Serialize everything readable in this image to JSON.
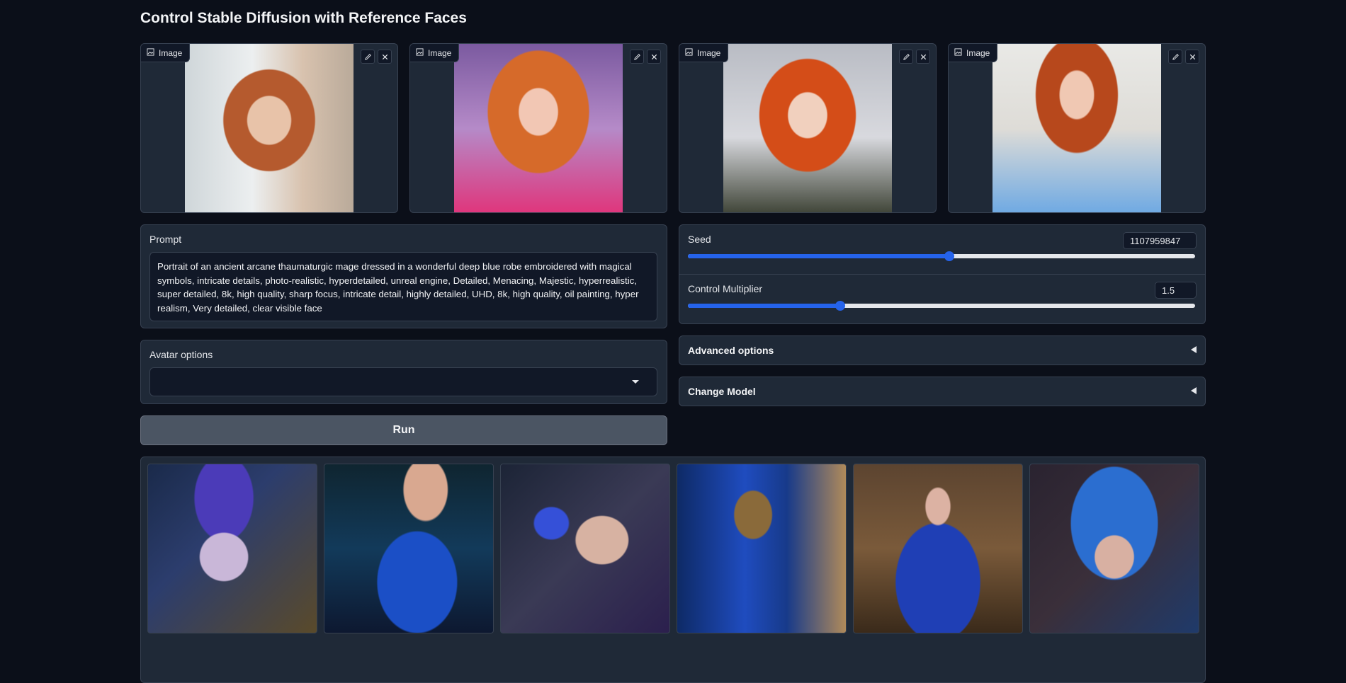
{
  "page": {
    "title": "Control Stable Diffusion with Reference Faces"
  },
  "image_inputs": [
    {
      "label": "Image"
    },
    {
      "label": "Image"
    },
    {
      "label": "Image"
    },
    {
      "label": "Image"
    }
  ],
  "prompt": {
    "label": "Prompt",
    "value": "Portrait of an ancient arcane thaumaturgic mage dressed in a wonderful deep blue robe embroidered with magical symbols, intricate details, photo-realistic, hyperdetailed, unreal engine, Detailed, Menacing, Majestic, hyperrealistic, super detailed, 8k, high quality, sharp focus, intricate detail, highly detailed, UHD, 8k, high quality, oil painting, hyper realism, Very detailed, clear visible face"
  },
  "avatar_options": {
    "label": "Avatar options",
    "value": ""
  },
  "run": {
    "label": "Run"
  },
  "seed": {
    "label": "Seed",
    "value": "1107959847",
    "fraction": 0.516
  },
  "control_multiplier": {
    "label": "Control Multiplier",
    "value": "1.5",
    "fraction": 0.3
  },
  "advanced_options": {
    "label": "Advanced options"
  },
  "change_model": {
    "label": "Change Model"
  },
  "gallery": {
    "count": 6
  },
  "colors": {
    "accent": "#2563eb",
    "background": "#0b0f19",
    "panel": "#1f2937"
  }
}
